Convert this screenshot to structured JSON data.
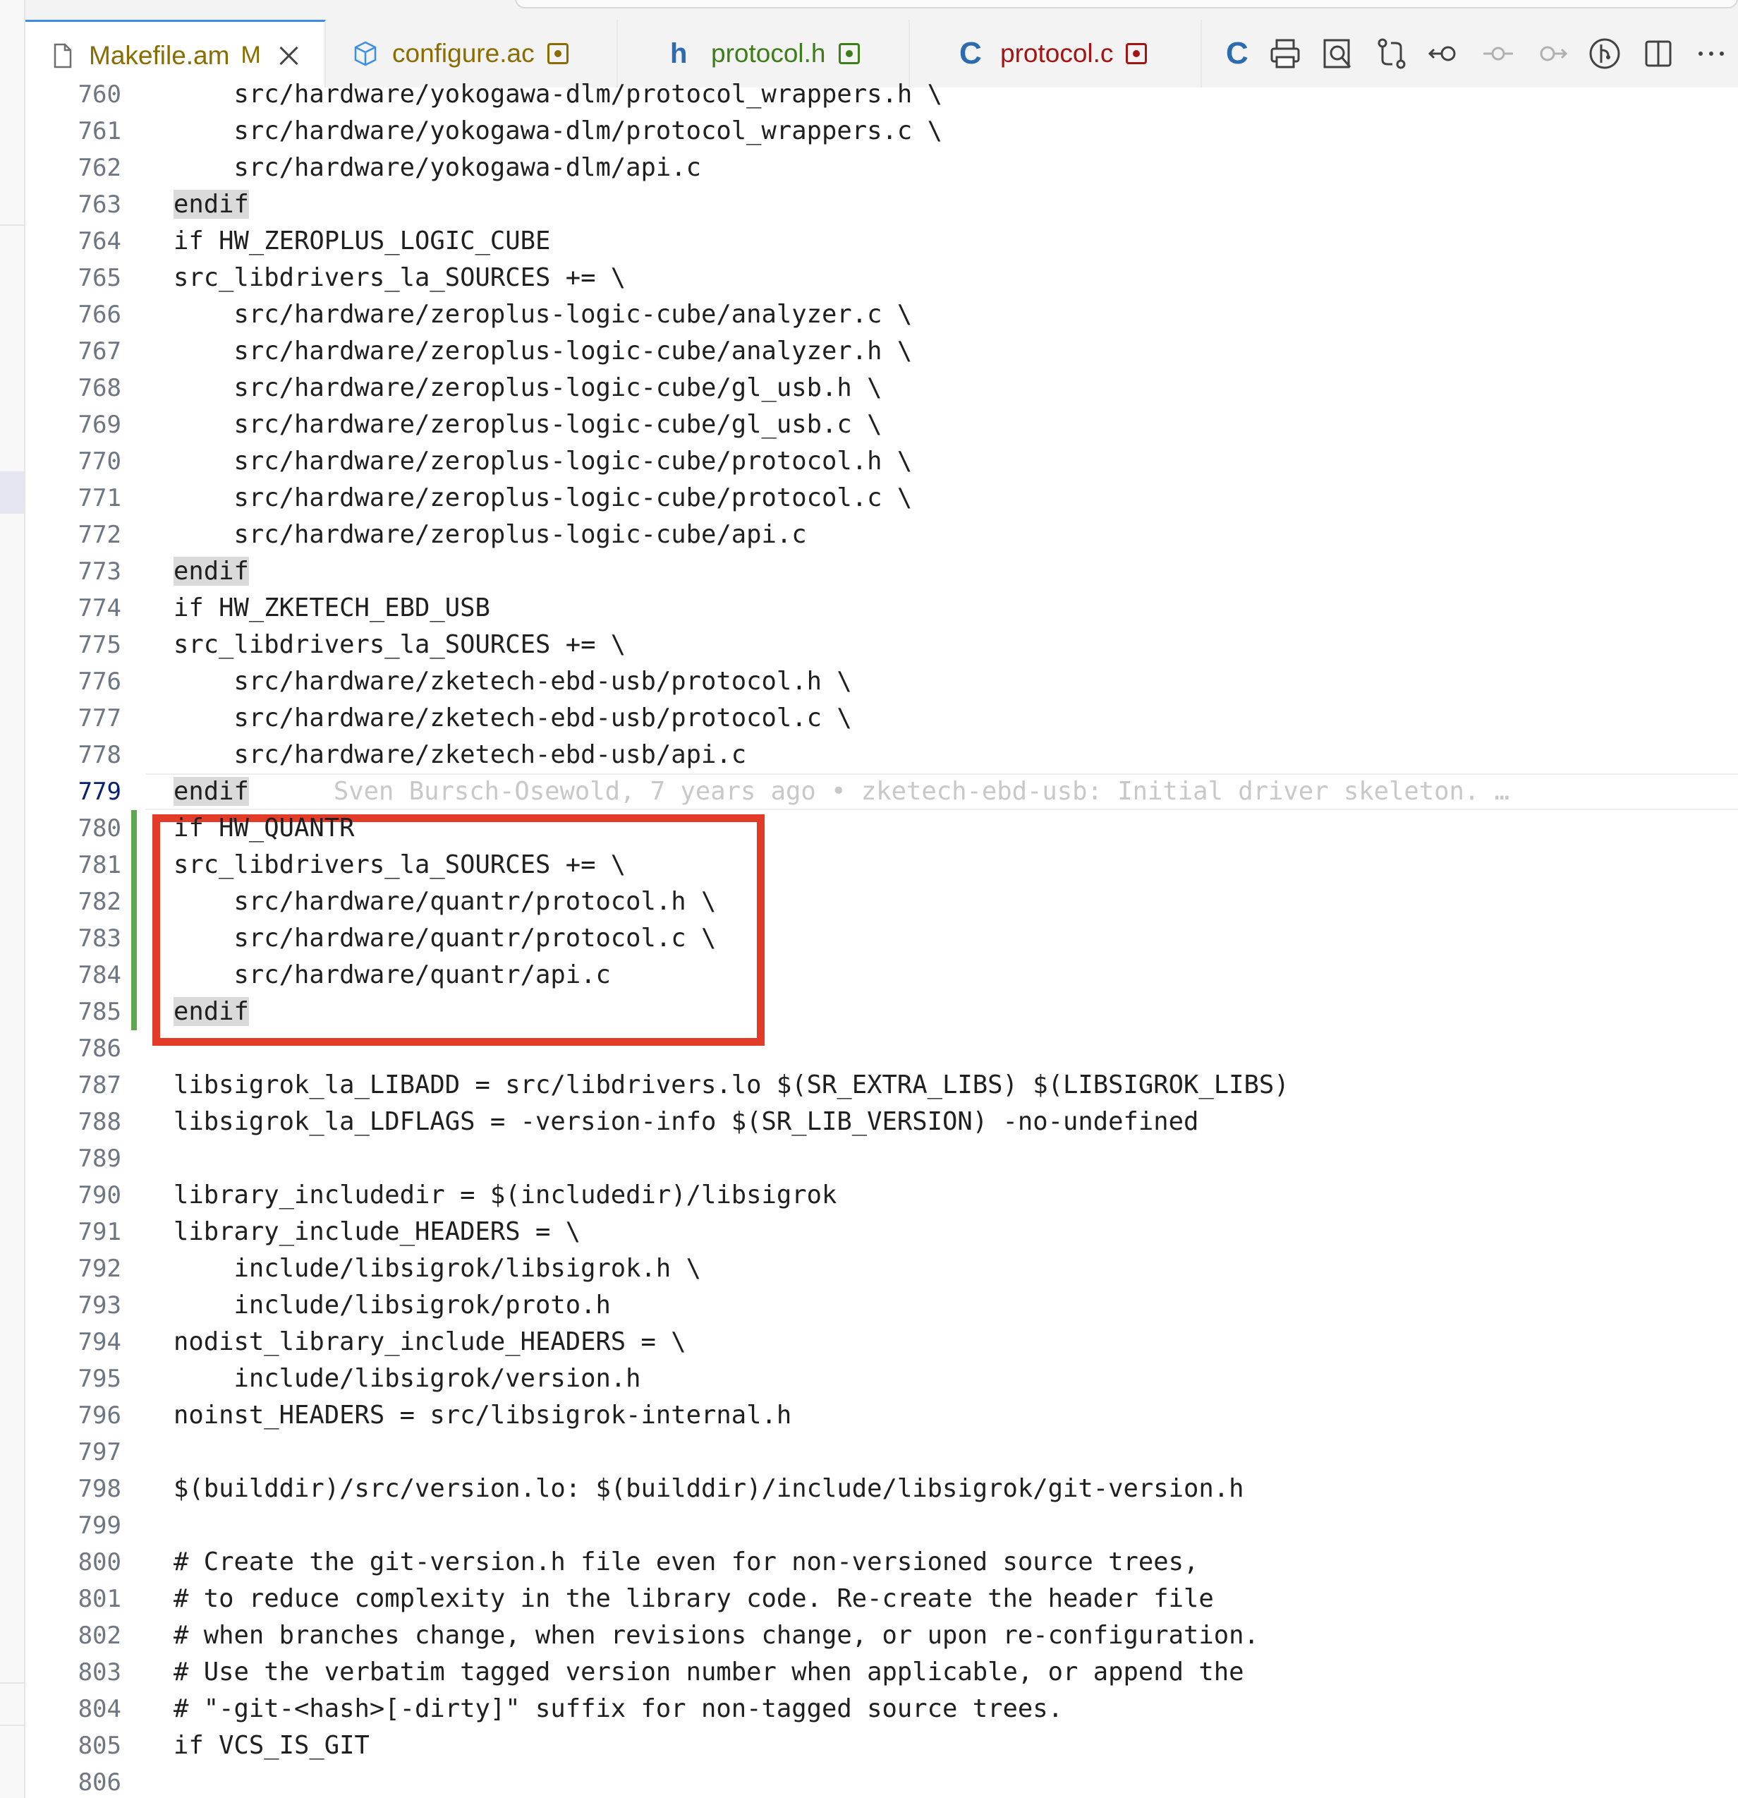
{
  "tabs": [
    {
      "label": "Makefile.am",
      "badge": "M",
      "badge_color": "#8a6d00",
      "label_color": "#8a6d00",
      "icon": "file-icon",
      "active": true
    },
    {
      "label": "configure.ac",
      "badge": "",
      "label_color": "#8a6d00",
      "icon": "package-icon",
      "dot_color": "#8a6d00"
    },
    {
      "label": "protocol.h",
      "badge": "",
      "label_color": "#3f7d1a",
      "icon": "header-h-icon",
      "icon_text": "h",
      "dot_color": "#3f7d1a"
    },
    {
      "label": "protocol.c",
      "badge": "",
      "label_color": "#a31515",
      "icon": "c-file-icon",
      "icon_text": "C",
      "dot_color": "#a31515"
    }
  ],
  "toolbar": [
    {
      "name": "c-file-icon-partial"
    },
    {
      "name": "print-icon"
    },
    {
      "name": "open-preview-icon"
    },
    {
      "name": "compare-changes-icon"
    },
    {
      "name": "previous-change-icon"
    },
    {
      "name": "timeline-dot-icon"
    },
    {
      "name": "next-change-icon"
    },
    {
      "name": "git-graph-icon"
    },
    {
      "name": "split-editor-icon"
    },
    {
      "name": "more-actions-icon"
    }
  ],
  "editor": {
    "current_line": 779,
    "blame": "Sven Bursch-Osewold, 7 years ago • zketech-ebd-usb: Initial driver skeleton. …",
    "lines": [
      {
        "n": "760",
        "text": "    src/hardware/yokogawa-dlm/protocol_wrappers.h \\"
      },
      {
        "n": "761",
        "text": "    src/hardware/yokogawa-dlm/protocol_wrappers.c \\"
      },
      {
        "n": "762",
        "text": "    src/hardware/yokogawa-dlm/api.c"
      },
      {
        "n": "763",
        "text": "endif",
        "endif": true
      },
      {
        "n": "764",
        "text": "if HW_ZEROPLUS_LOGIC_CUBE"
      },
      {
        "n": "765",
        "text": "src_libdrivers_la_SOURCES += \\"
      },
      {
        "n": "766",
        "text": "    src/hardware/zeroplus-logic-cube/analyzer.c \\"
      },
      {
        "n": "767",
        "text": "    src/hardware/zeroplus-logic-cube/analyzer.h \\"
      },
      {
        "n": "768",
        "text": "    src/hardware/zeroplus-logic-cube/gl_usb.h \\"
      },
      {
        "n": "769",
        "text": "    src/hardware/zeroplus-logic-cube/gl_usb.c \\"
      },
      {
        "n": "770",
        "text": "    src/hardware/zeroplus-logic-cube/protocol.h \\"
      },
      {
        "n": "771",
        "text": "    src/hardware/zeroplus-logic-cube/protocol.c \\"
      },
      {
        "n": "772",
        "text": "    src/hardware/zeroplus-logic-cube/api.c"
      },
      {
        "n": "773",
        "text": "endif",
        "endif": true
      },
      {
        "n": "774",
        "text": "if HW_ZKETECH_EBD_USB"
      },
      {
        "n": "775",
        "text": "src_libdrivers_la_SOURCES += \\"
      },
      {
        "n": "776",
        "text": "    src/hardware/zketech-ebd-usb/protocol.h \\"
      },
      {
        "n": "777",
        "text": "    src/hardware/zketech-ebd-usb/protocol.c \\"
      },
      {
        "n": "778",
        "text": "    src/hardware/zketech-ebd-usb/api.c"
      },
      {
        "n": "779",
        "text": "endif",
        "endif": true,
        "blame": true
      },
      {
        "n": "780",
        "text": "if HW_QUANTR",
        "added": true
      },
      {
        "n": "781",
        "text": "src_libdrivers_la_SOURCES += \\",
        "added": true
      },
      {
        "n": "782",
        "text": "    src/hardware/quantr/protocol.h \\",
        "added": true
      },
      {
        "n": "783",
        "text": "    src/hardware/quantr/protocol.c \\",
        "added": true
      },
      {
        "n": "784",
        "text": "    src/hardware/quantr/api.c",
        "added": true
      },
      {
        "n": "785",
        "text": "endif",
        "endif": true,
        "added": true
      },
      {
        "n": "786",
        "text": ""
      },
      {
        "n": "787",
        "text": "libsigrok_la_LIBADD = src/libdrivers.lo $(SR_EXTRA_LIBS) $(LIBSIGROK_LIBS)"
      },
      {
        "n": "788",
        "text": "libsigrok_la_LDFLAGS = -version-info $(SR_LIB_VERSION) -no-undefined"
      },
      {
        "n": "789",
        "text": ""
      },
      {
        "n": "790",
        "text": "library_includedir = $(includedir)/libsigrok"
      },
      {
        "n": "791",
        "text": "library_include_HEADERS = \\"
      },
      {
        "n": "792",
        "text": "    include/libsigrok/libsigrok.h \\"
      },
      {
        "n": "793",
        "text": "    include/libsigrok/proto.h"
      },
      {
        "n": "794",
        "text": "nodist_library_include_HEADERS = \\"
      },
      {
        "n": "795",
        "text": "    include/libsigrok/version.h"
      },
      {
        "n": "796",
        "text": "noinst_HEADERS = src/libsigrok-internal.h"
      },
      {
        "n": "797",
        "text": ""
      },
      {
        "n": "798",
        "text": "$(builddir)/src/version.lo: $(builddir)/include/libsigrok/git-version.h"
      },
      {
        "n": "799",
        "text": ""
      },
      {
        "n": "800",
        "text": "# Create the git-version.h file even for non-versioned source trees,"
      },
      {
        "n": "801",
        "text": "# to reduce complexity in the library code. Re-create the header file"
      },
      {
        "n": "802",
        "text": "# when branches change, when revisions change, or upon re-configuration."
      },
      {
        "n": "803",
        "text": "# Use the verbatim tagged version number when applicable, or append the"
      },
      {
        "n": "804",
        "text": "# \"-git-<hash>[-dirty]\" suffix for non-tagged source trees."
      },
      {
        "n": "805",
        "text": "if VCS_IS_GIT"
      },
      {
        "n": "806",
        "text": ""
      }
    ]
  },
  "colors": {
    "accent": "#3b8eea",
    "added_gutter": "#5fa84d",
    "annotation_box": "#e23b28"
  }
}
